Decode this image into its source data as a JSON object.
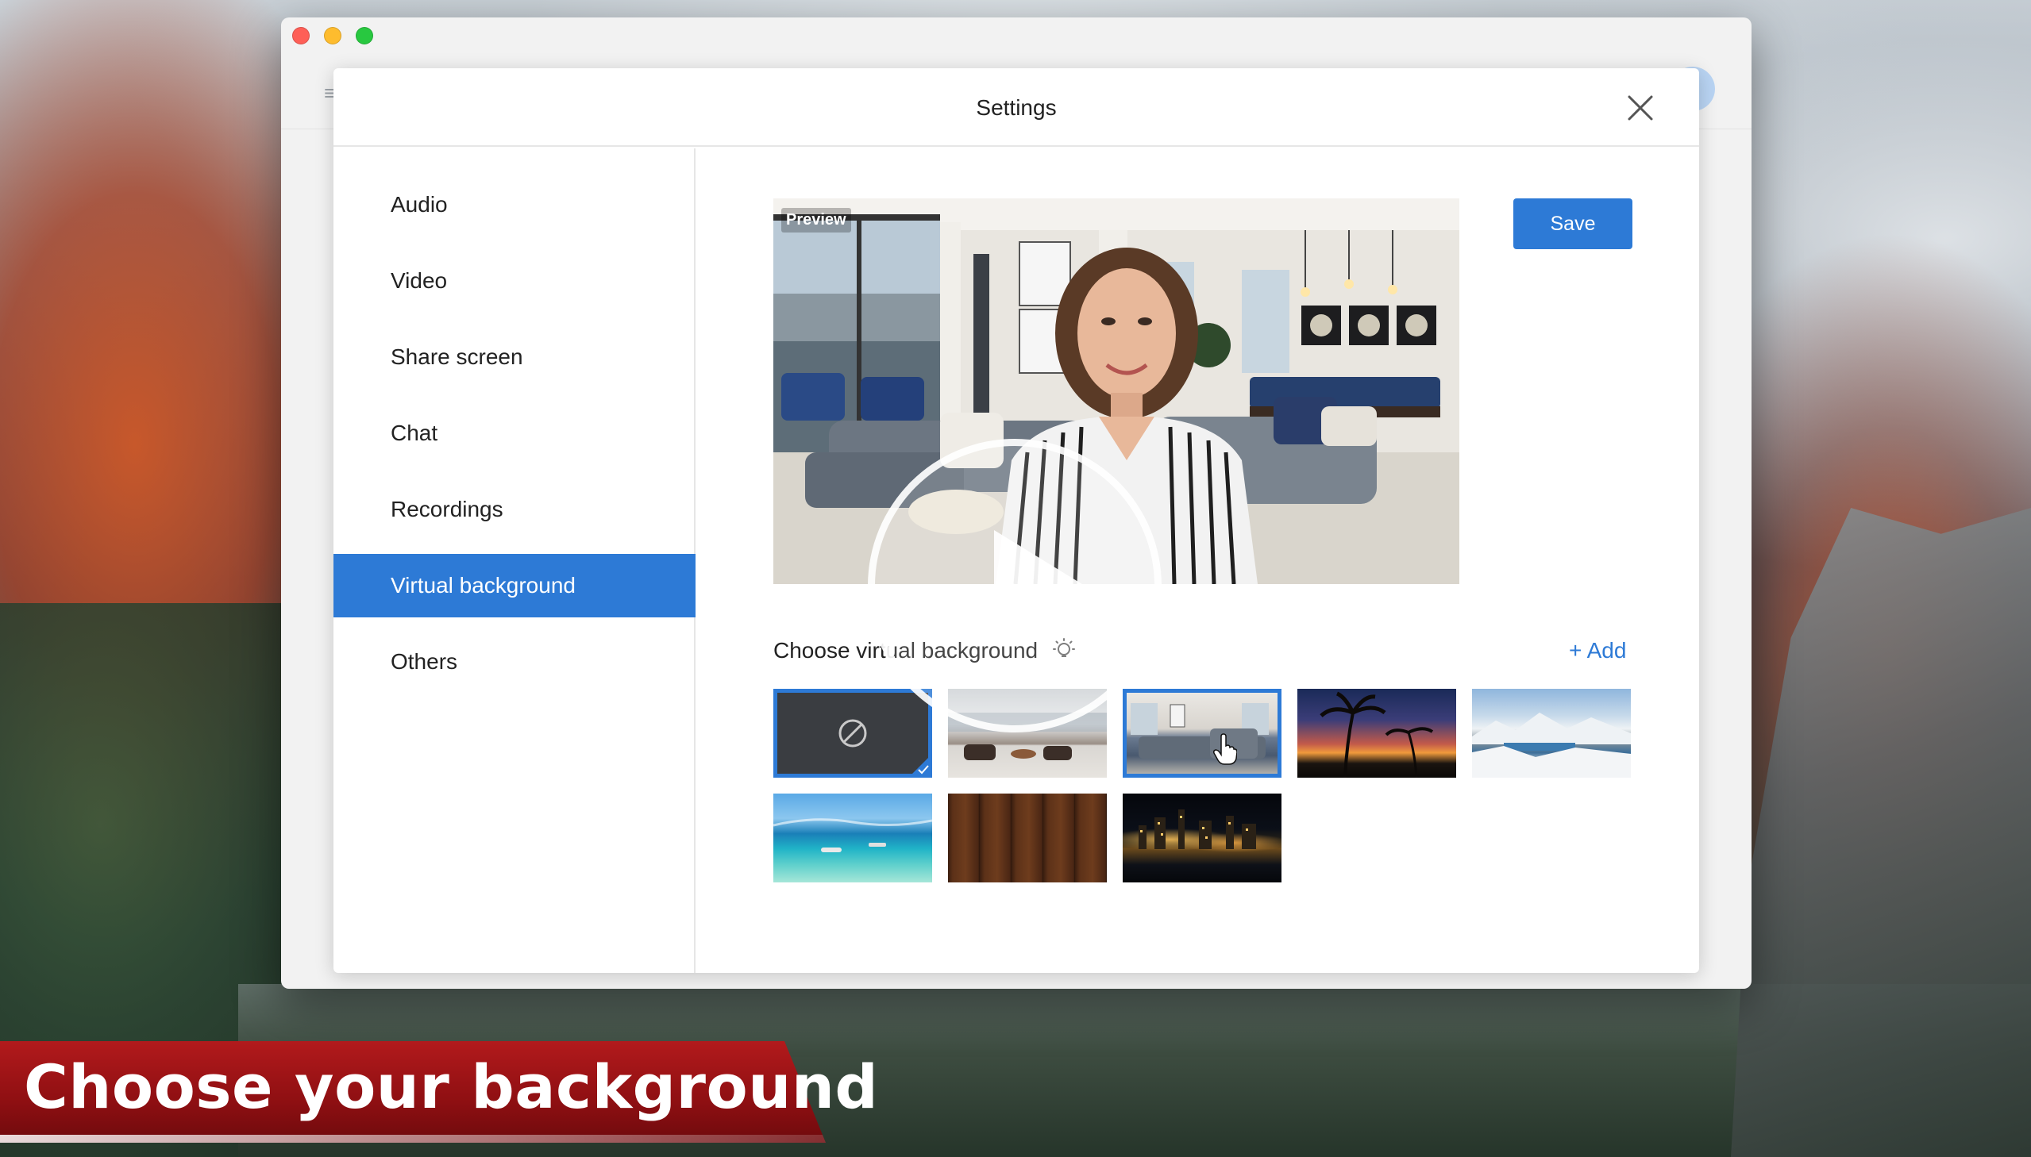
{
  "settings_dialog": {
    "title": "Settings",
    "close_icon": "close-icon",
    "sidebar": {
      "items": [
        {
          "label": "Audio",
          "active": false
        },
        {
          "label": "Video",
          "active": false
        },
        {
          "label": "Share screen",
          "active": false
        },
        {
          "label": "Chat",
          "active": false
        },
        {
          "label": "Recordings",
          "active": false
        },
        {
          "label": "Virtual background",
          "active": true
        },
        {
          "label": "Others",
          "active": false
        }
      ]
    },
    "preview": {
      "label": "Preview"
    },
    "save_label": "Save",
    "choose_label": "Choose virtual background",
    "add_label": "+ Add",
    "backgrounds": [
      {
        "name": "none",
        "selected": true
      },
      {
        "name": "loft-living-room",
        "selected": false
      },
      {
        "name": "modern-living-room",
        "selected": false,
        "hovered": true
      },
      {
        "name": "palm-sunset",
        "selected": false
      },
      {
        "name": "snowy-mountains",
        "selected": false
      },
      {
        "name": "tropical-beach",
        "selected": false
      },
      {
        "name": "wood-planks",
        "selected": false
      },
      {
        "name": "city-night",
        "selected": false
      }
    ]
  },
  "overlay": {
    "play_icon": "play-icon",
    "caption": "Choose your background"
  },
  "colors": {
    "accent": "#2d7ad6",
    "caption_banner": "#a5161a"
  }
}
